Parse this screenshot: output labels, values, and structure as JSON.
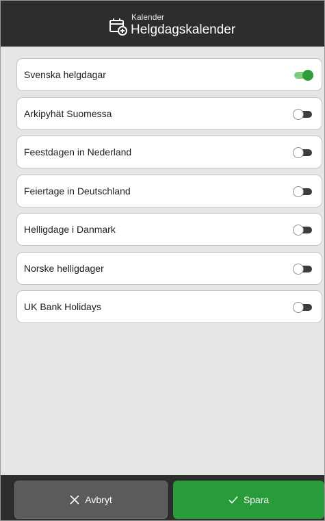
{
  "header": {
    "subtitle": "Kalender",
    "title": "Helgdagskalender",
    "icon": "calendar-add-icon"
  },
  "calendars": [
    {
      "label": "Svenska helgdagar",
      "enabled": true
    },
    {
      "label": "Arkipyhät Suomessa",
      "enabled": false
    },
    {
      "label": "Feestdagen in Nederland",
      "enabled": false
    },
    {
      "label": "Feiertage in Deutschland",
      "enabled": false
    },
    {
      "label": "Helligdage i Danmark",
      "enabled": false
    },
    {
      "label": "Norske helligdager",
      "enabled": false
    },
    {
      "label": "UK Bank Holidays",
      "enabled": false
    }
  ],
  "footer": {
    "cancel_label": "Avbryt",
    "cancel_icon": "close-icon",
    "save_label": "Spara",
    "save_icon": "checkmark-icon"
  },
  "colors": {
    "header_bg": "#2d2d2d",
    "background": "#e6e6e6",
    "accent_green": "#2a9b3b",
    "toggle_on_track": "#7dcc80",
    "cancel_bg": "#5b5b5b"
  }
}
